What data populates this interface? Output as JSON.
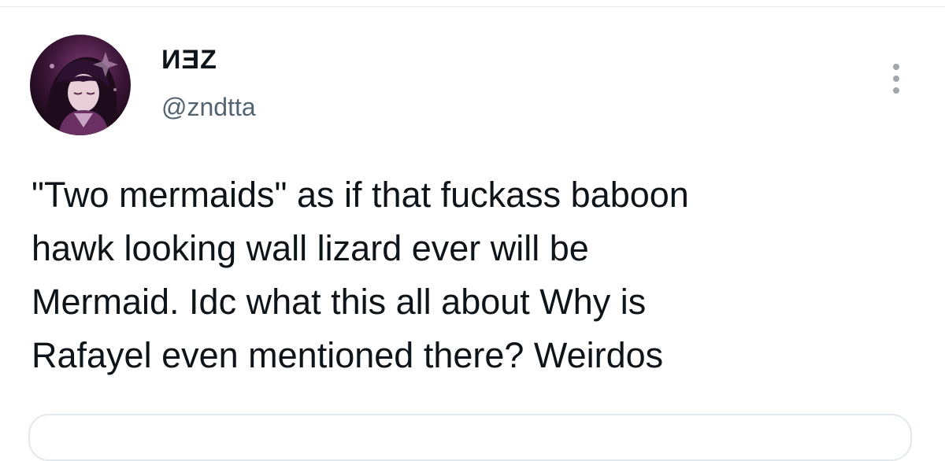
{
  "tweet": {
    "author": {
      "display_name": "ИƎZ",
      "handle": "@zndtta",
      "avatar_icon": "profile-avatar-anime-character"
    },
    "more_icon": "more-vertical-icon",
    "text": "\"Two mermaids\" as if that fuckass baboon\nhawk looking wall lizard ever will be\nMermaid. Idc what this all about Why is\nRafayel even mentioned there? Weirdos"
  },
  "colors": {
    "text_primary": "#0f1419",
    "text_secondary": "#536471",
    "border": "#e3e8ec",
    "icon_gray": "#a0a6ab"
  }
}
